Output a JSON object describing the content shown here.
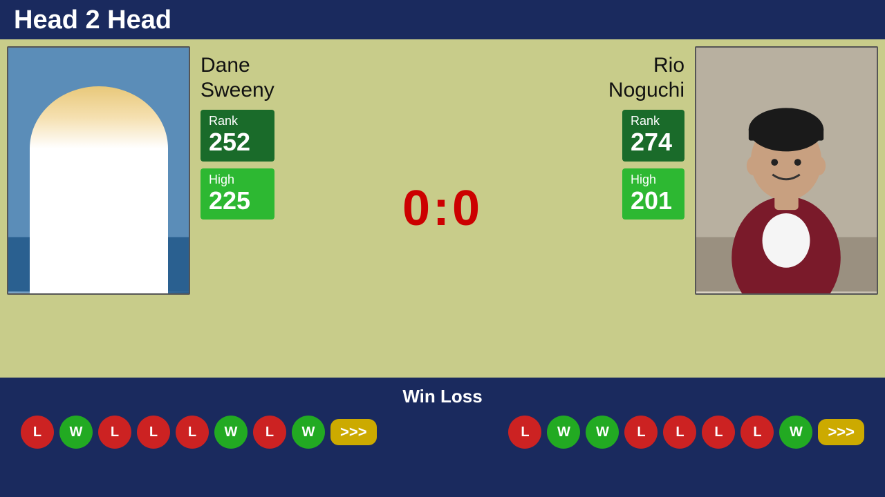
{
  "header": {
    "title": "Head 2 Head"
  },
  "player_left": {
    "first_name": "Dane",
    "last_name": "Sweeny",
    "rank_label": "Rank",
    "rank_value": "252",
    "high_label": "High",
    "high_value": "225"
  },
  "player_right": {
    "first_name": "Rio",
    "last_name": "Noguchi",
    "rank_label": "Rank",
    "rank_value": "274",
    "high_label": "High",
    "high_value": "201"
  },
  "score": {
    "display": "0:0"
  },
  "win_loss": {
    "title": "Win Loss",
    "left_badges": [
      "L",
      "W",
      "L",
      "L",
      "L",
      "W",
      "L",
      "W"
    ],
    "right_badges": [
      "L",
      "W",
      "W",
      "L",
      "L",
      "L",
      "L",
      "W"
    ],
    "more_symbol": ">>>"
  }
}
